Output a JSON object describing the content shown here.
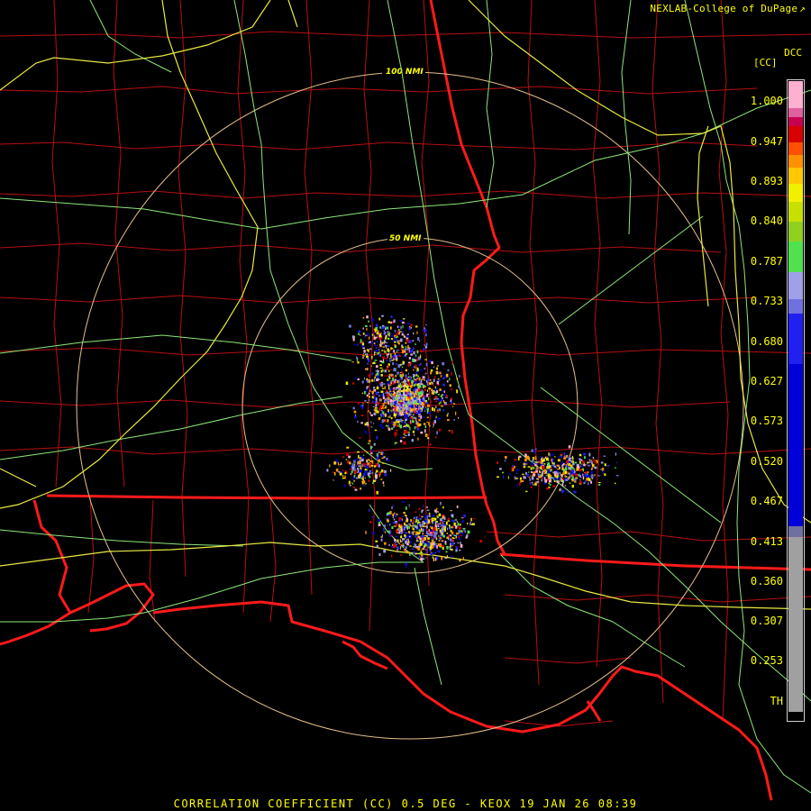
{
  "header": {
    "credit": "NEXLAB-College of DuPage",
    "credit_icon": "external-link-arrow-icon",
    "product_code": "DCC"
  },
  "legend": {
    "unit": "[CC]",
    "ticks": [
      "1.000",
      "0.947",
      "0.893",
      "0.840",
      "0.787",
      "0.733",
      "0.680",
      "0.627",
      "0.573",
      "0.520",
      "0.467",
      "0.413",
      "0.360",
      "0.307",
      "0.253",
      "TH"
    ],
    "scale_top_color": "#ffb0d0",
    "scale_bottom_color": "#000000"
  },
  "map": {
    "range_rings": [
      {
        "label": "100 NMI"
      },
      {
        "label": "50 NMI"
      }
    ],
    "colors": {
      "state_border": "#ff1a1a",
      "county_border": "#c01010",
      "highway": "#e8e840",
      "road": "#8ce878",
      "range_ring": "#e6c08a",
      "background": "#000000"
    }
  },
  "footer": {
    "caption": "CORRELATION COEFFICIENT (CC) 0.5 DEG - KEOX 19 JAN 26 08:39"
  }
}
